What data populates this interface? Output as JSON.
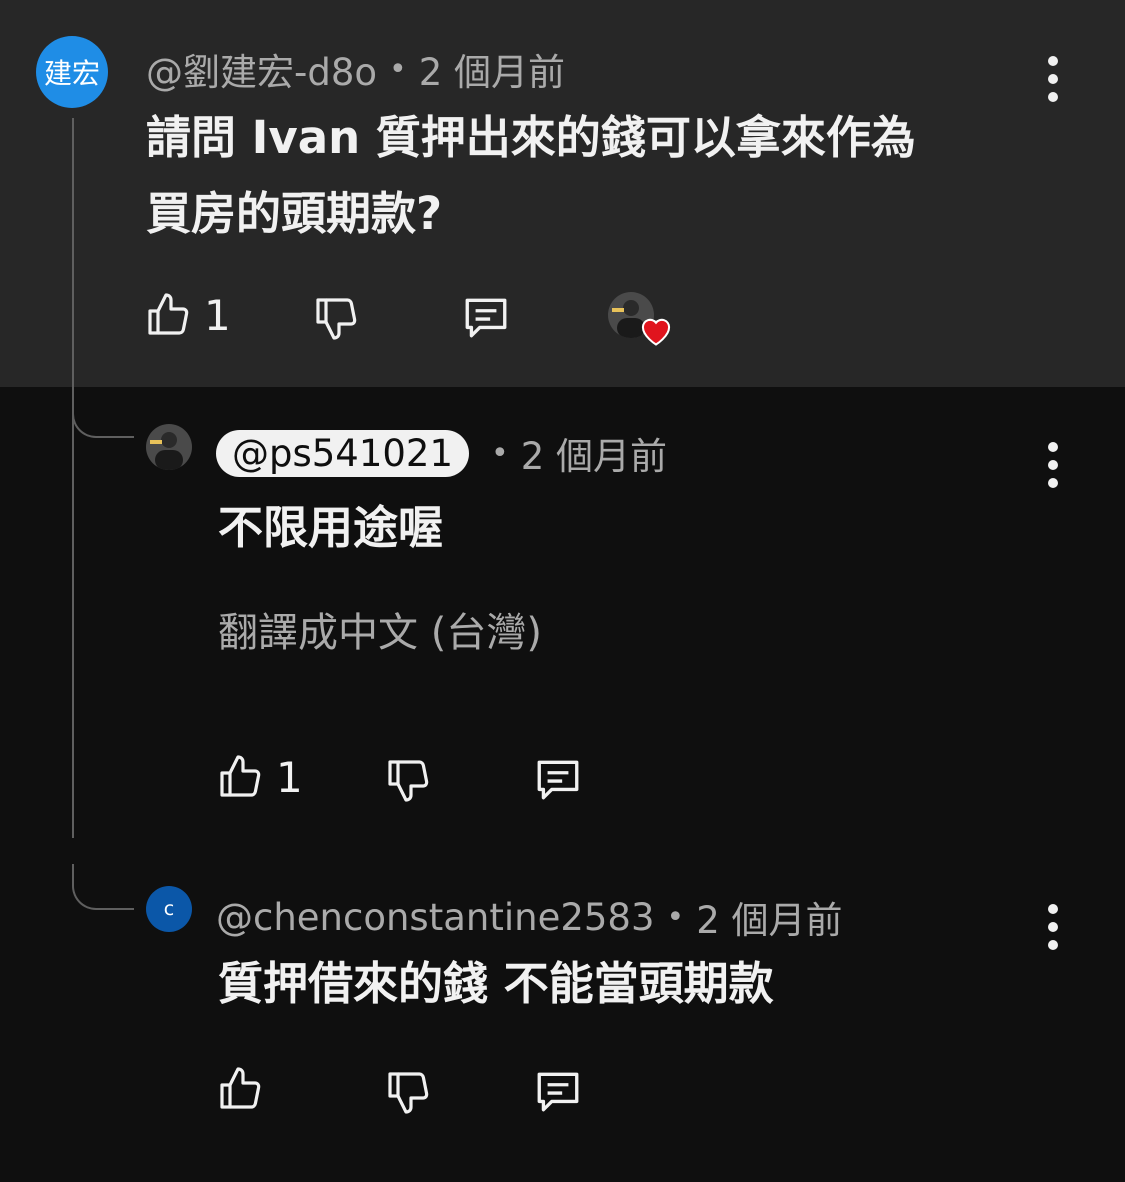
{
  "comments": [
    {
      "avatar_text": "建宏",
      "author": "@劉建宏-d8o",
      "time": "2 個月前",
      "text_line1": "請問 Ivan 質押出來的錢可以拿來作為",
      "text_line2": "買房的頭期款?",
      "likes": "1"
    }
  ],
  "replies": [
    {
      "author": "@ps541021",
      "time": "2 個月前",
      "text": "不限用途喔",
      "translate_label": "翻譯成中文 (台灣)",
      "likes": "1"
    },
    {
      "avatar_text": "c",
      "author": "@chenconstantine2583",
      "time": "2 個月前",
      "text": "質押借來的錢 不能當頭期款",
      "likes": ""
    }
  ],
  "separator": "•",
  "icons": [
    "thumb-up-icon",
    "thumb-down-icon",
    "reply-icon",
    "more-vert-icon",
    "creator-heart-icon"
  ],
  "colors": {
    "top_bg": "#272727",
    "page_bg": "#0f0f0f",
    "avatar_blue": "#1f8de6",
    "heart": "#e0141e"
  }
}
